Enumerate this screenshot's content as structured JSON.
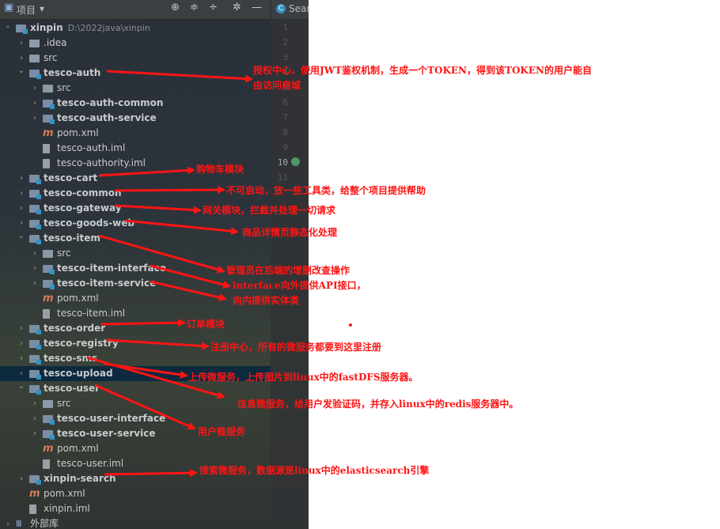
{
  "toolbar": {
    "project_label": "项目",
    "dropdown_icon": "▾",
    "icons": [
      "target-icon",
      "expand-icon",
      "collapse-icon",
      "gear-icon",
      "minimize-icon"
    ]
  },
  "editor_tab": {
    "label": "Sear",
    "icon_color": "#3592c4"
  },
  "line_numbers": [
    "1",
    "2",
    "3",
    "4",
    "5",
    "6",
    "7",
    "8",
    "9",
    "10",
    "11"
  ],
  "tree": [
    {
      "label": "xinpin",
      "path": "D:\\2022java\\xinpin",
      "indent": 0,
      "arrow": "v",
      "icon": "module",
      "bold": true
    },
    {
      "label": ".idea",
      "indent": 1,
      "arrow": ">",
      "icon": "folder"
    },
    {
      "label": "src",
      "indent": 1,
      "arrow": ">",
      "icon": "folder"
    },
    {
      "label": "tesco-auth",
      "indent": 1,
      "arrow": "v",
      "icon": "module",
      "bold": true
    },
    {
      "label": "src",
      "indent": 2,
      "arrow": ">",
      "icon": "folder"
    },
    {
      "label": "tesco-auth-common",
      "indent": 2,
      "arrow": ">",
      "icon": "module",
      "bold": true
    },
    {
      "label": "tesco-auth-service",
      "indent": 2,
      "arrow": ">",
      "icon": "module",
      "bold": true
    },
    {
      "label": "pom.xml",
      "indent": 2,
      "arrow": "",
      "icon": "maven"
    },
    {
      "label": "tesco-auth.iml",
      "indent": 2,
      "arrow": "",
      "icon": "iml"
    },
    {
      "label": "tesco-authority.iml",
      "indent": 2,
      "arrow": "",
      "icon": "iml"
    },
    {
      "label": "tesco-cart",
      "indent": 1,
      "arrow": ">",
      "icon": "module",
      "bold": true
    },
    {
      "label": "tesco-common",
      "indent": 1,
      "arrow": ">",
      "icon": "module",
      "bold": true
    },
    {
      "label": "tesco-gateway",
      "indent": 1,
      "arrow": ">",
      "icon": "module",
      "bold": true
    },
    {
      "label": "tesco-goods-web",
      "indent": 1,
      "arrow": ">",
      "icon": "module",
      "bold": true
    },
    {
      "label": "tesco-item",
      "indent": 1,
      "arrow": "v",
      "icon": "module",
      "bold": true
    },
    {
      "label": "src",
      "indent": 2,
      "arrow": ">",
      "icon": "folder"
    },
    {
      "label": "tesco-item-interface",
      "indent": 2,
      "arrow": ">",
      "icon": "module",
      "bold": true
    },
    {
      "label": "tesco-item-service",
      "indent": 2,
      "arrow": ">",
      "icon": "module",
      "bold": true
    },
    {
      "label": "pom.xml",
      "indent": 2,
      "arrow": "",
      "icon": "maven"
    },
    {
      "label": "tesco-item.iml",
      "indent": 2,
      "arrow": "",
      "icon": "iml"
    },
    {
      "label": "tesco-order",
      "indent": 1,
      "arrow": ">",
      "icon": "module",
      "bold": true
    },
    {
      "label": "tesco-registry",
      "indent": 1,
      "arrow": ">",
      "icon": "module",
      "bold": true
    },
    {
      "label": "tesco-sms",
      "indent": 1,
      "arrow": ">",
      "icon": "module",
      "bold": true
    },
    {
      "label": "tesco-upload",
      "indent": 1,
      "arrow": ">",
      "icon": "module",
      "bold": true,
      "selected": true
    },
    {
      "label": "tesco-user",
      "indent": 1,
      "arrow": "v",
      "icon": "module",
      "bold": true
    },
    {
      "label": "src",
      "indent": 2,
      "arrow": ">",
      "icon": "folder"
    },
    {
      "label": "tesco-user-interface",
      "indent": 2,
      "arrow": ">",
      "icon": "module",
      "bold": true
    },
    {
      "label": "tesco-user-service",
      "indent": 2,
      "arrow": ">",
      "icon": "module",
      "bold": true
    },
    {
      "label": "pom.xml",
      "indent": 2,
      "arrow": "",
      "icon": "maven"
    },
    {
      "label": "tesco-user.iml",
      "indent": 2,
      "arrow": "",
      "icon": "iml"
    },
    {
      "label": "xinpin-search",
      "indent": 1,
      "arrow": ">",
      "icon": "module",
      "bold": true
    },
    {
      "label": "pom.xml",
      "indent": 1,
      "arrow": "",
      "icon": "maven"
    },
    {
      "label": "xinpin.iml",
      "indent": 1,
      "arrow": "",
      "icon": "iml"
    },
    {
      "label": "外部库",
      "indent": 0,
      "arrow": ">",
      "icon": "lib"
    }
  ],
  "annotations": {
    "color": "#ff1414",
    "auth_1": "授权中心，使用JWT鉴权机制，生成一个TOKEN，得到该TOKEN的用户能自",
    "auth_2": "由访问商城",
    "cart": "购物车模块",
    "common": "不可启动，放一些工具类，给整个项目提供帮助",
    "gateway": "网关模块，拦截并处理一切请求",
    "goods_web": "商品详情页静态化处理",
    "item_1": "管理员在后端的增删改查操作",
    "item_2": "interface向外提供API接口，",
    "item_3": "向内提供实体类",
    "order": "订单模块",
    "registry": "注册中心，所有的微服务都要到这里注册",
    "upload": "上传微服务，上传图片到linux中的fastDFS服务器。",
    "sms": "信息微服务，给用户发验证码，并存入linux中的redis服务器中。",
    "user": "用户微服务",
    "search": "搜索微服务，数据源是linux中的elasticsearch引擎"
  }
}
